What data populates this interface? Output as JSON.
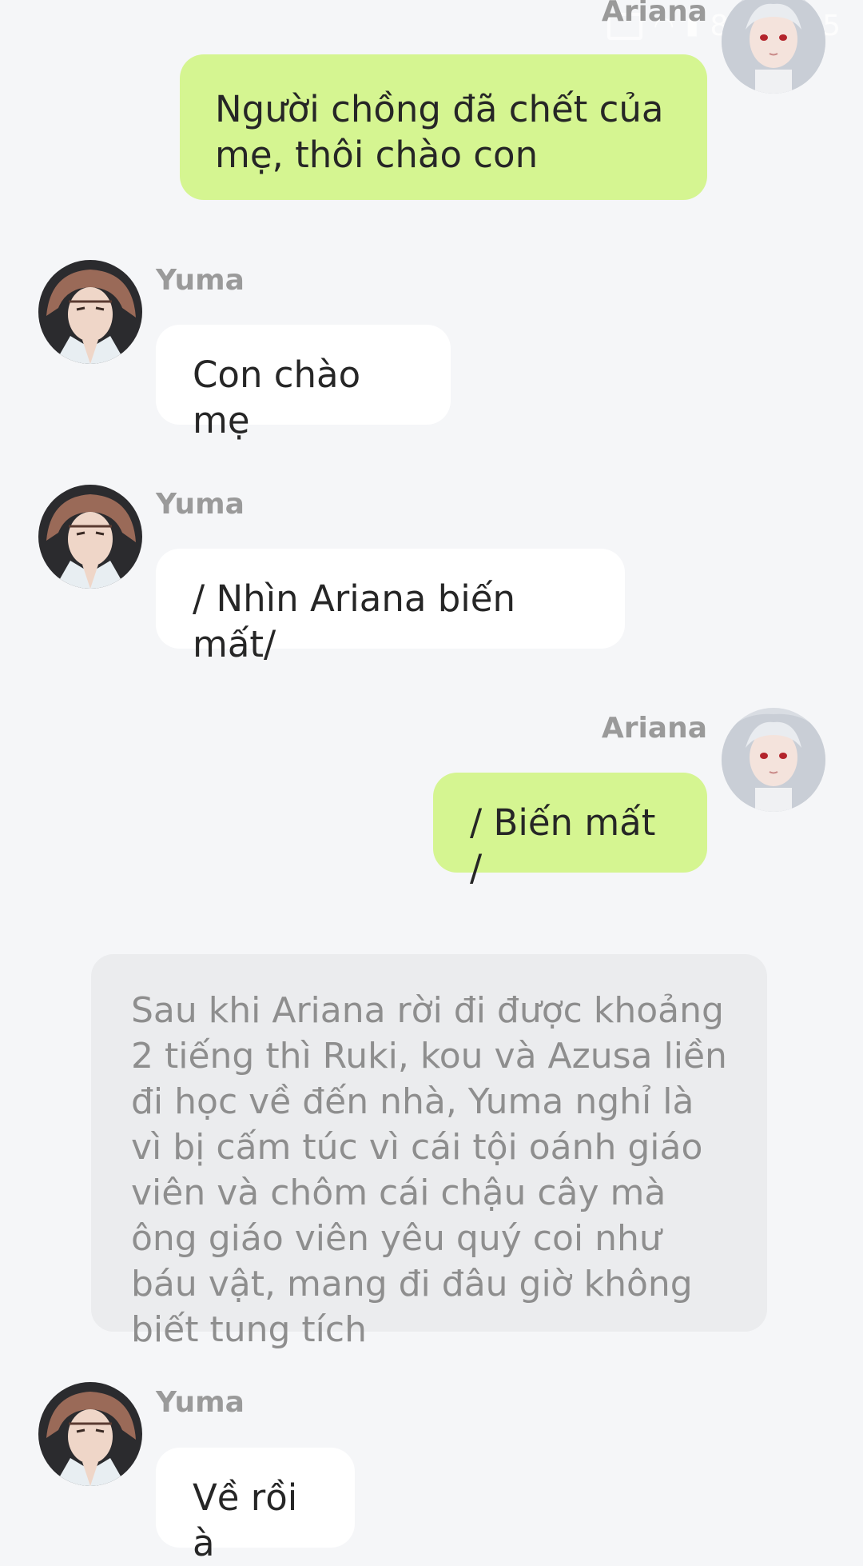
{
  "status_bar": {
    "battery_text": "84",
    "time": "17:05",
    "icons": [
      "cast-icon",
      "wifi-icon",
      "signal-icon",
      "battery-icon"
    ]
  },
  "messages": [
    {
      "sender": "Ariana",
      "side": "right",
      "text": "Người chồng đã chết của mẹ, thôi chào con",
      "bubble_color": "#d5f591"
    },
    {
      "sender": "Yuma",
      "side": "left",
      "text": "Con chào mẹ",
      "bubble_color": "#ffffff"
    },
    {
      "sender": "Yuma",
      "side": "left",
      "text": "/ Nhìn Ariana biến mất/",
      "bubble_color": "#ffffff"
    },
    {
      "sender": "Ariana",
      "side": "right",
      "text": "/ Biến mất /",
      "bubble_color": "#d5f591"
    },
    {
      "sender": "Yuma",
      "side": "left",
      "text": "Về rồi à",
      "bubble_color": "#ffffff"
    }
  ],
  "narration": {
    "text": "Sau khi Ariana rời đi được khoảng 2 tiếng thì Ruki, kou và Azusa liền đi học về đến nhà, Yuma nghỉ là vì bị cấm túc vì cái tội oánh giáo viên và chôm cái chậu cây mà ông giáo viên yêu quý coi như báu vật, mang đi đâu giờ không biết tung tích"
  },
  "colors": {
    "background": "#f5f6f8",
    "sent_bubble": "#d5f591",
    "received_bubble": "#ffffff",
    "narration_bubble": "#ebecee",
    "name_text": "#9a9a9a"
  }
}
